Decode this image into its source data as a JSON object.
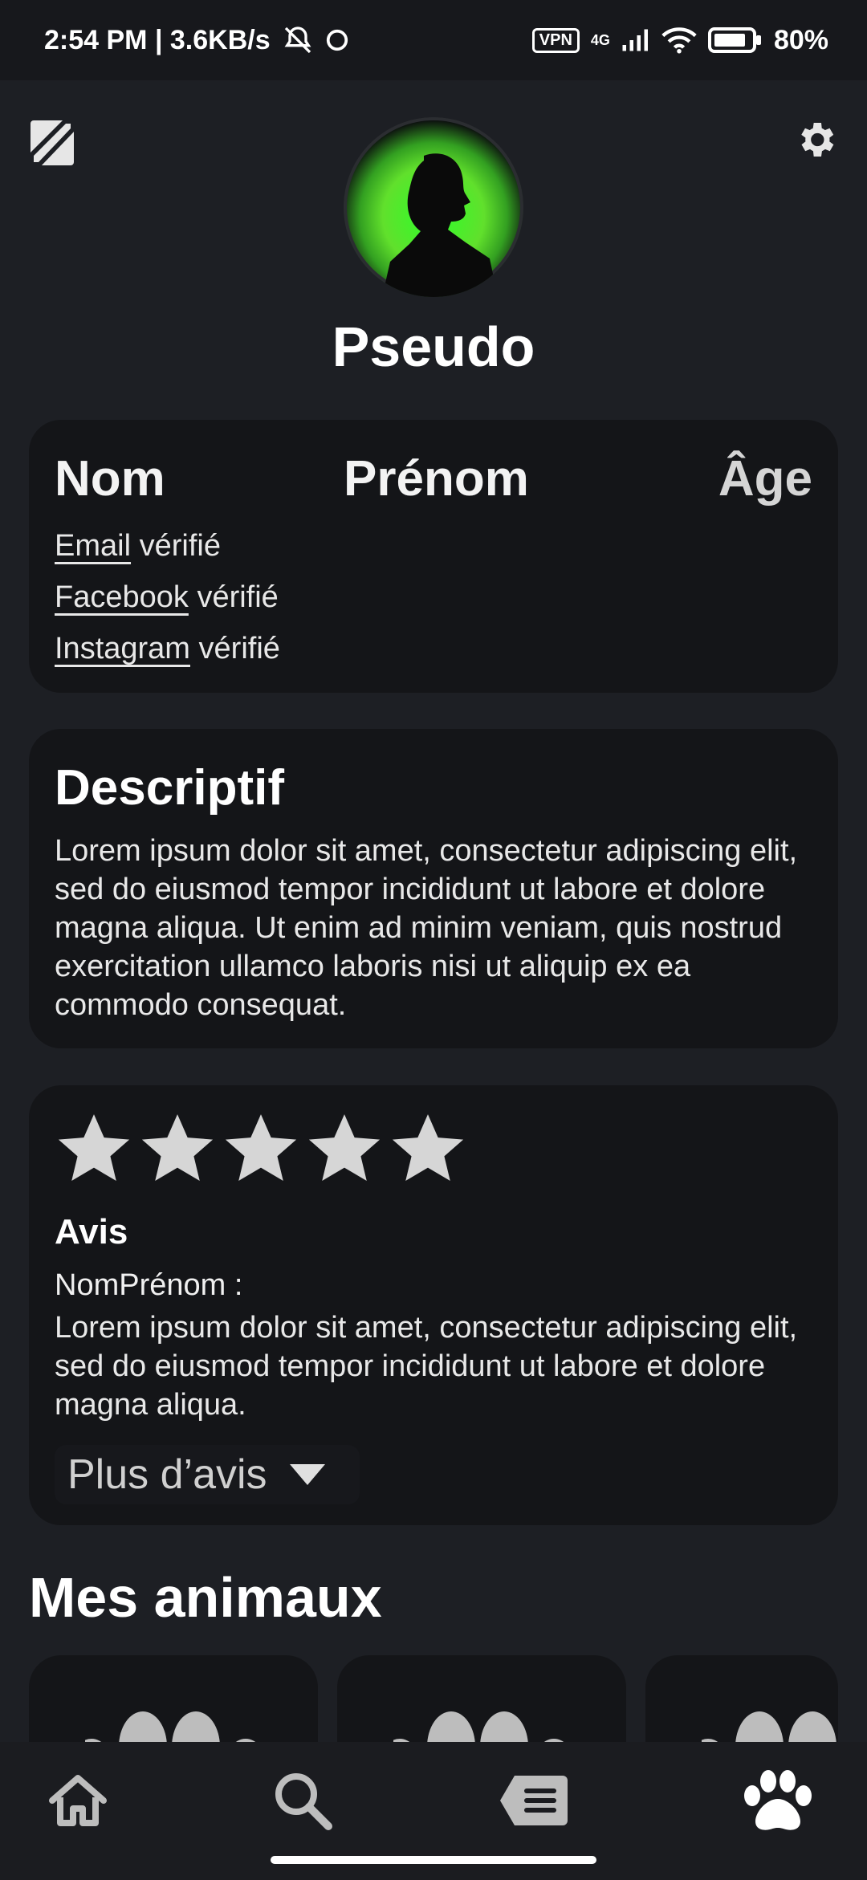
{
  "status_bar": {
    "time_speed": "2:54 PM | 3.6KB/s",
    "vpn": "VPN",
    "network": "4G",
    "battery": "80%"
  },
  "profile": {
    "pseudo": "Pseudo",
    "nom": "Nom",
    "prenom": "Prénom",
    "age": "Âge"
  },
  "verifications": [
    {
      "link": "Email",
      "status": " vérifié"
    },
    {
      "link": "Facebook",
      "status": " vérifié"
    },
    {
      "link": "Instagram",
      "status": " vérifié"
    }
  ],
  "description": {
    "title": "Descriptif",
    "text": "Lorem ipsum dolor sit amet, consectetur adipiscing elit, sed do eiusmod tempor incididunt ut labore et dolore magna aliqua. Ut enim ad minim veniam, quis nostrud exercitation ullamco laboris nisi ut aliquip ex ea commodo consequat."
  },
  "reviews": {
    "rating": 5,
    "max_rating": 5,
    "title": "Avis",
    "author": "NomPrénom :",
    "text": "Lorem ipsum dolor sit amet, consectetur adipiscing elit, sed do eiusmod tempor incididunt ut labore et dolore magna aliqua.",
    "more_label": "Plus d’avis"
  },
  "pets": {
    "title": "Mes animaux",
    "count_visible": 3
  },
  "nav": {
    "items": [
      "home-icon",
      "search-icon",
      "tag-icon",
      "paw-icon"
    ],
    "active": "paw-icon"
  },
  "colors": {
    "background": "#1d1f24",
    "card": "#141518",
    "avatar_accent": "#2cff2a",
    "star": "#d6d6d6"
  }
}
